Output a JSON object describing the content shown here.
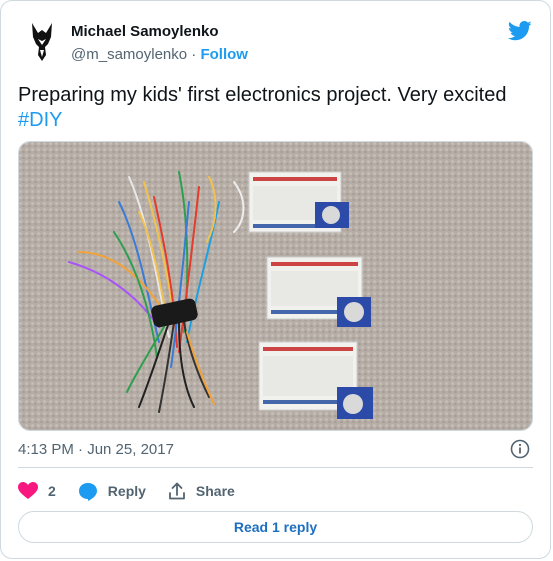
{
  "author": {
    "name": "Michael Samoylenko",
    "handle": "@m_samoylenko",
    "separator": " · ",
    "follow_label": "Follow"
  },
  "tweet": {
    "text": "Preparing my kids' first electronics project. Very excited ",
    "hashtag": "#DIY"
  },
  "timestamp": "4:13 PM · Jun 25, 2017",
  "actions": {
    "likes_count": "2",
    "reply_label": "Reply",
    "share_label": "Share"
  },
  "read_replies_label": "Read 1 reply",
  "icons": {
    "like": "heart-icon",
    "reply": "speech-bubble-icon",
    "share": "share-icon",
    "info": "info-icon",
    "brand": "twitter-bird-icon"
  },
  "colors": {
    "accent": "#1d9bf0",
    "like": "#f91880",
    "text": "#0f1419",
    "secondary": "#536471"
  }
}
